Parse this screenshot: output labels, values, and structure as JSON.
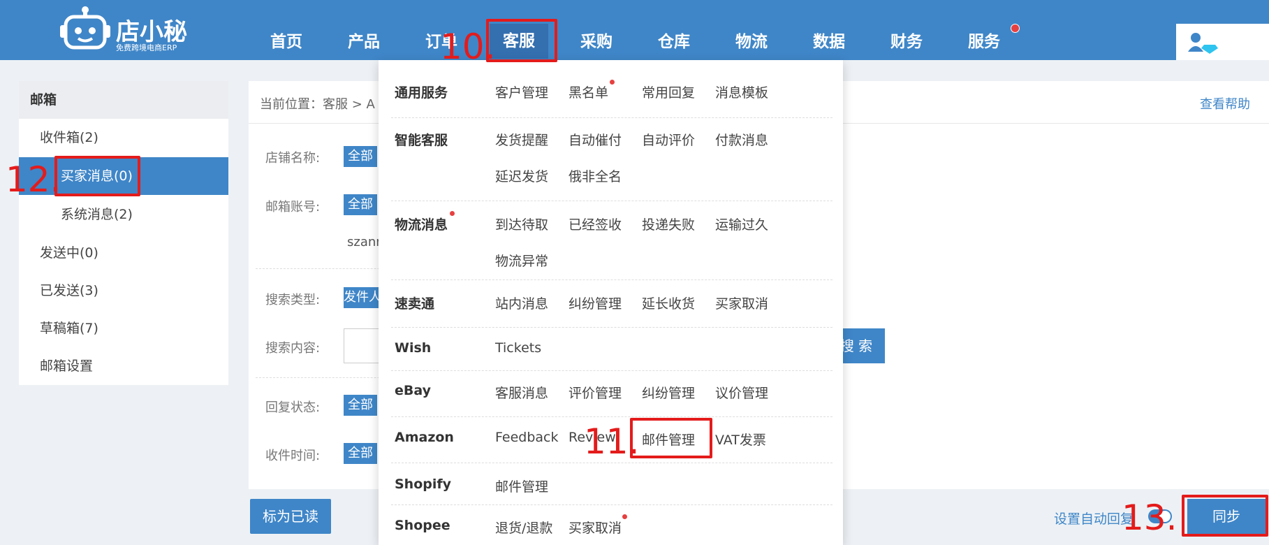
{
  "header": {
    "logo_title": "店小秘",
    "logo_subtitle": "免费跨境电商ERP",
    "nav": [
      {
        "label": "首页"
      },
      {
        "label": "产品"
      },
      {
        "label": "订单"
      },
      {
        "label": "客服"
      },
      {
        "label": "采购"
      },
      {
        "label": "仓库"
      },
      {
        "label": "物流"
      },
      {
        "label": "数据"
      },
      {
        "label": "财务"
      },
      {
        "label": "服务"
      }
    ],
    "active_nav": "客服",
    "accent_color": "#3f86c8"
  },
  "sidebar": {
    "title": "邮箱",
    "items": [
      {
        "label": "收件箱(2)"
      },
      {
        "label": "买家消息(0)"
      },
      {
        "label": "系统消息(2)"
      },
      {
        "label": "发送中(0)"
      },
      {
        "label": "已发送(3)"
      },
      {
        "label": "草稿箱(7)"
      },
      {
        "label": "邮箱设置"
      }
    ],
    "active_item": "买家消息(0)"
  },
  "main": {
    "breadcrumb": "当前位置：客服 > A",
    "help_link": "查看帮助",
    "filters": {
      "store_label": "店铺名称:",
      "store_value": "全部",
      "mail_label": "邮箱账号:",
      "mail_value": "全部",
      "mail_account_partial": "szann",
      "search_type_label": "搜索类型:",
      "search_type_value": "发件人",
      "search_content_label": "搜索内容:",
      "search_button": "搜 索",
      "reply_status_label": "回复状态:",
      "reply_status_value": "全部",
      "received_time_label": "收件时间:",
      "received_time_value": "全部"
    },
    "mark_read_button": "标为已读",
    "auto_reply_label": "设置自动回复",
    "sync_button": "同步"
  },
  "dropdown": {
    "categories": [
      {
        "name": "通用服务",
        "items": [
          "客户管理",
          "黑名单",
          "常用回复",
          "消息模板"
        ]
      },
      {
        "name": "智能客服",
        "items": [
          "发货提醒",
          "自动催付",
          "自动评价",
          "付款消息",
          "延迟发货",
          "俄非全名"
        ]
      },
      {
        "name": "物流消息",
        "items": [
          "到达待取",
          "已经签收",
          "投递失败",
          "运输过久",
          "物流异常"
        ]
      },
      {
        "name": "速卖通",
        "items": [
          "站内消息",
          "纠纷管理",
          "延长收货",
          "买家取消"
        ]
      },
      {
        "name": "Wish",
        "items": [
          "Tickets"
        ]
      },
      {
        "name": "eBay",
        "items": [
          "客服消息",
          "评价管理",
          "纠纷管理",
          "议价管理"
        ]
      },
      {
        "name": "Amazon",
        "items": [
          "Feedback",
          "Review",
          "邮件管理",
          "VAT发票"
        ]
      },
      {
        "name": "Shopify",
        "items": [
          "邮件管理"
        ]
      },
      {
        "name": "Shopee",
        "items": [
          "退货/退款",
          "买家取消"
        ]
      }
    ]
  },
  "annotations": {
    "step10": "10.",
    "step11": "11.",
    "step12": "12.",
    "step13": "13.",
    "color": "#e41b1b"
  }
}
